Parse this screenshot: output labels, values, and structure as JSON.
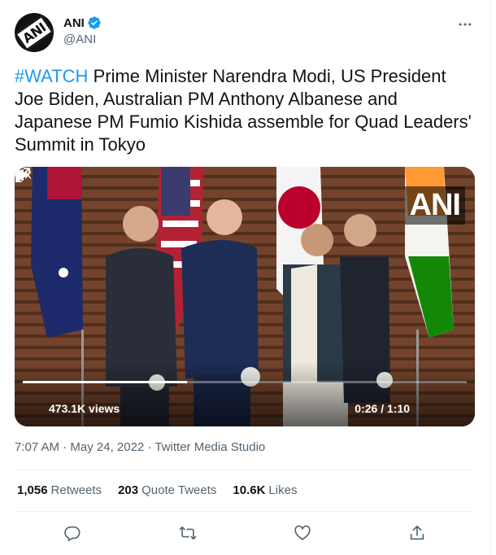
{
  "author": {
    "display_name": "ANI",
    "handle": "@ANI",
    "avatar_logo_text": "ANI",
    "verified": true
  },
  "tweet": {
    "hashtag": "#WATCH",
    "text": " Prime Minister Narendra Modi, US President Joe Biden, Australian PM Anthony Albanese and Japanese PM Fumio Kishida assemble for Quad Leaders' Summit in Tokyo"
  },
  "video": {
    "watermark": "ANI",
    "views": "473.1K views",
    "time": "0:26 / 1:10",
    "progress_fraction": 0.37
  },
  "meta": {
    "time": "7:07 AM",
    "separator": "·",
    "date": "May 24, 2022",
    "source": "Twitter Media Studio"
  },
  "stats": {
    "retweets_count": "1,056",
    "retweets_label": "Retweets",
    "quotes_count": "203",
    "quotes_label": "Quote Tweets",
    "likes_count": "10.6K",
    "likes_label": "Likes"
  },
  "icons": {
    "more": "more-icon",
    "reply": "reply-icon",
    "retweet": "retweet-icon",
    "like": "heart-icon",
    "share": "share-icon",
    "play": "play-icon",
    "volume": "volume-icon",
    "fullscreen": "fullscreen-icon"
  },
  "colors": {
    "accent": "#1d9bf0",
    "text": "#0f1419",
    "muted": "#536471"
  }
}
